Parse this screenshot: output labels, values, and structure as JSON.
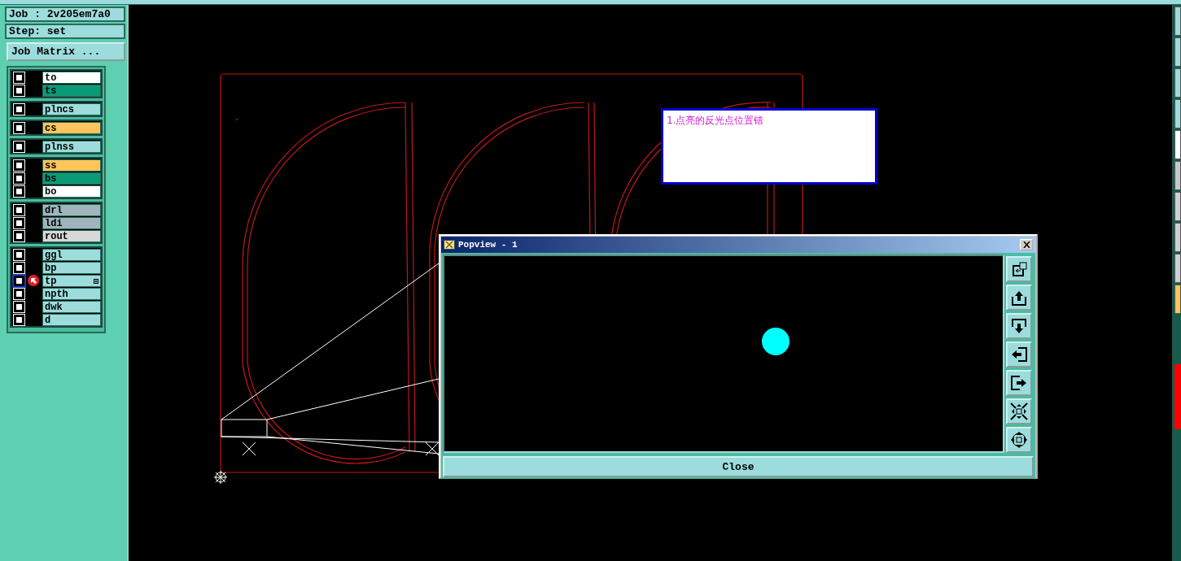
{
  "job": {
    "label": "Job : 2v205em7a0"
  },
  "step": {
    "label": "Step: set"
  },
  "job_matrix_button": "Job Matrix ...",
  "layer_groups": [
    {
      "layers": [
        {
          "name": "to",
          "color": "#ffffff",
          "checked": false,
          "selected": false
        },
        {
          "name": "ts",
          "color": "#0a9a78",
          "checked": false,
          "selected": false
        }
      ]
    },
    {
      "layers": [
        {
          "name": "plncs",
          "color": "#9ddcdc",
          "checked": false,
          "selected": false
        }
      ]
    },
    {
      "layers": [
        {
          "name": "cs",
          "color": "#ffc45a",
          "checked": false,
          "selected": false
        }
      ]
    },
    {
      "layers": [
        {
          "name": "plnss",
          "color": "#9ddcdc",
          "checked": false,
          "selected": false
        }
      ]
    },
    {
      "layers": [
        {
          "name": "ss",
          "color": "#ffc45a",
          "checked": false,
          "selected": false
        },
        {
          "name": "bs",
          "color": "#0a9a78",
          "checked": false,
          "selected": false
        },
        {
          "name": "bo",
          "color": "#ffffff",
          "checked": false,
          "selected": false
        }
      ]
    },
    {
      "layers": [
        {
          "name": "drl",
          "color": "#a0b4bc",
          "checked": false,
          "selected": false
        },
        {
          "name": "ldi",
          "color": "#a0b4bc",
          "checked": false,
          "selected": false
        },
        {
          "name": "rout",
          "color": "#d8d8d8",
          "checked": false,
          "selected": false
        }
      ]
    },
    {
      "layers": [
        {
          "name": "ggl",
          "color": "#9ddcdc",
          "checked": false,
          "selected": false
        },
        {
          "name": "bp",
          "color": "#9ddcdc",
          "checked": false,
          "selected": false
        },
        {
          "name": "tp",
          "color": "#9ddcdc",
          "checked": false,
          "selected": true
        },
        {
          "name": "npth",
          "color": "#9ddcdc",
          "checked": false,
          "selected": false
        },
        {
          "name": "dwk",
          "color": "#9ddcdc",
          "checked": false,
          "selected": false
        },
        {
          "name": "d",
          "color": "#9ddcdc",
          "checked": false,
          "selected": false
        }
      ]
    }
  ],
  "note": {
    "text": "1.点亮的反光点位置错"
  },
  "popview": {
    "title": "Popview - 1",
    "close_button": "Close"
  }
}
